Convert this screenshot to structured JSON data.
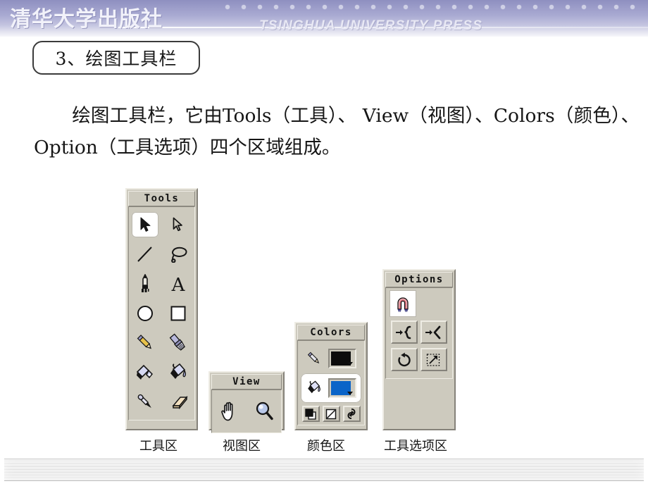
{
  "header": {
    "logo_cn": "清华大学出版社",
    "logo_en": "TSINGHUA UNIVERSITY PRESS",
    "dot_count": 26,
    "gradient_top": "#8e8fc0",
    "gradient_bottom": "#f7f7fb",
    "dot_color": "#cfd0e6"
  },
  "title": {
    "text": "3、绘图工具栏"
  },
  "body": {
    "line1": "绘图工具栏，它由Tools（工具）、 View（视图）、Colors",
    "line2": "（颜色）、Option（工具选项）四个区域组成。"
  },
  "palettes": {
    "tools": {
      "title": "Tools",
      "items": [
        {
          "icon": "arrow-select-icon",
          "selected": true
        },
        {
          "icon": "arrow-direct-select-icon",
          "selected": false
        },
        {
          "icon": "line-icon",
          "selected": false
        },
        {
          "icon": "lasso-icon",
          "selected": false
        },
        {
          "icon": "pen-icon",
          "selected": false
        },
        {
          "icon": "text-icon",
          "selected": false
        },
        {
          "icon": "ellipse-icon",
          "selected": false
        },
        {
          "icon": "rectangle-icon",
          "selected": false
        },
        {
          "icon": "pencil-icon",
          "selected": false
        },
        {
          "icon": "brush-icon",
          "selected": false
        },
        {
          "icon": "ink-bottle-icon",
          "selected": false
        },
        {
          "icon": "paint-bucket-icon",
          "selected": false
        },
        {
          "icon": "eyedropper-icon",
          "selected": false
        },
        {
          "icon": "eraser-icon",
          "selected": false
        }
      ],
      "caption": "工具区"
    },
    "view": {
      "title": "View",
      "items": [
        {
          "icon": "hand-icon"
        },
        {
          "icon": "magnifier-icon"
        }
      ],
      "caption": "视图区"
    },
    "colors": {
      "title": "Colors",
      "rows": [
        {
          "icon": "stroke-pencil-icon",
          "swatch_color": "#0c0c0c",
          "selected": false
        },
        {
          "icon": "fill-bucket-icon",
          "swatch_color": "#0a64c8",
          "selected": true
        }
      ],
      "mini_buttons": [
        {
          "icon": "default-colors-icon"
        },
        {
          "icon": "no-color-icon"
        },
        {
          "icon": "swap-colors-icon"
        }
      ],
      "caption": "颜色区"
    },
    "options": {
      "title": "Options",
      "single": {
        "icon": "magnet-snap-icon"
      },
      "rows": [
        [
          {
            "icon": "smooth-icon"
          },
          {
            "icon": "straighten-icon"
          }
        ],
        [
          {
            "icon": "rotate-icon"
          },
          {
            "icon": "scale-icon"
          }
        ]
      ],
      "caption": "工具选项区"
    }
  },
  "footer": {
    "style": "striped-gray-band"
  }
}
